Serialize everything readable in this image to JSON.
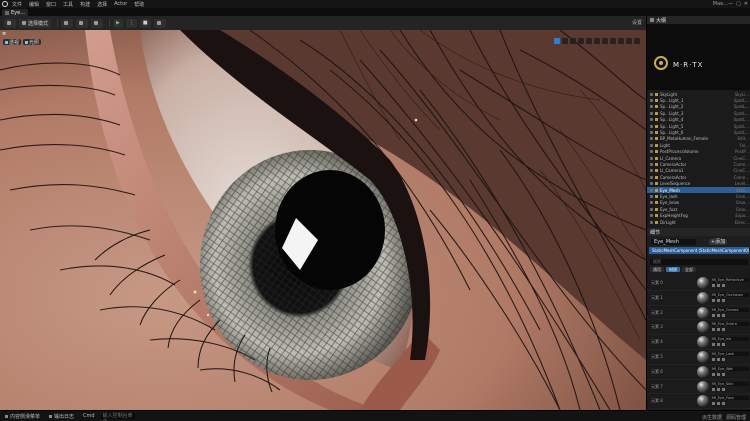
{
  "menubar": {
    "items": [
      "文件",
      "编辑",
      "窗口",
      "工具",
      "构建",
      "选择",
      "Actor",
      "帮助"
    ],
    "project": "Mae...",
    "window_buttons": [
      "—",
      "▢",
      "✕"
    ]
  },
  "tab": {
    "label": "Eye..."
  },
  "toolbar": {
    "mode_label": "选择模式",
    "buttons": [
      "",
      "",
      ""
    ],
    "right_label": "设置"
  },
  "viewport": {
    "corner_label": "≡",
    "buttons": [
      "透视",
      "光照"
    ]
  },
  "outliner": {
    "title": "大纲",
    "brand": "M·R·TX",
    "rows": [
      {
        "name": "SkyLight",
        "type": "SkyLi..."
      },
      {
        "name": "Sp.. Light_1",
        "type": "SpotL..."
      },
      {
        "name": "Sp.. Light_2",
        "type": "SpotL..."
      },
      {
        "name": "Sp.. Light_3",
        "type": "SpotL..."
      },
      {
        "name": "Sp.. Light_4",
        "type": "SpotL..."
      },
      {
        "name": "Sp.. Light_5",
        "type": "SpotL..."
      },
      {
        "name": "Sp.. Light_6",
        "type": "SpotL..."
      },
      {
        "name": "BP_MetaHuman_Female",
        "type": "Edit..."
      },
      {
        "name": "Light",
        "type": "Fol..."
      },
      {
        "name": "PostProcessVolume",
        "type": "PostP..."
      },
      {
        "name": "Ll_Camera",
        "type": "CineC..."
      },
      {
        "name": "CameraActor",
        "type": "Came..."
      },
      {
        "name": "Ll_Camera1",
        "type": "CineC..."
      },
      {
        "name": "CameraActor",
        "type": "Came..."
      },
      {
        "name": "LevelSequence",
        "type": "Level..."
      },
      {
        "name": "Eye_Mesh",
        "type": "Stati...",
        "selected": true
      },
      {
        "name": "Eye_lash",
        "type": "Groo..."
      },
      {
        "name": "Eye_brow",
        "type": "Groo..."
      },
      {
        "name": "Eye_fuzz",
        "type": "Groo..."
      },
      {
        "name": "ExpHeightFog",
        "type": "Expo..."
      },
      {
        "name": "DirLight",
        "type": "Direc..."
      }
    ]
  },
  "details": {
    "title": "细节",
    "actor_name": "Eye_Mesh",
    "add_button": "+添加",
    "component_row": "StaticMeshComponent (StaticMeshComponent0)",
    "search_placeholder": "搜索",
    "tabs": [
      "通用",
      "材质",
      "全部"
    ],
    "materials": [
      {
        "slot": "元素 0",
        "name": "MI_Eye_Refractive"
      },
      {
        "slot": "元素 1",
        "name": "MI_Eye_Occlusion"
      },
      {
        "slot": "元素 2",
        "name": "MI_Eye_Cornea"
      },
      {
        "slot": "元素 3",
        "name": "MI_Eye_Sclera"
      },
      {
        "slot": "元素 4",
        "name": "MI_Eye_Iris"
      },
      {
        "slot": "元素 5",
        "name": "MI_Eye_Lash"
      },
      {
        "slot": "元素 6",
        "name": "MI_Eye_Wet"
      },
      {
        "slot": "元素 7",
        "name": "MI_Eye_Skin"
      },
      {
        "slot": "元素 8",
        "name": "MI_Eye_Fuzz"
      }
    ]
  },
  "statusbar": {
    "items": [
      "内容侧滑菜单",
      "输出日志",
      "Cmd"
    ],
    "cmd_placeholder": "输入控制台命令",
    "right_items": [
      "派生数据",
      "源码管理"
    ]
  },
  "colors": {
    "accent": "#2b5e95",
    "brand_gold": "#c9b04a",
    "skin": "#b98571"
  }
}
